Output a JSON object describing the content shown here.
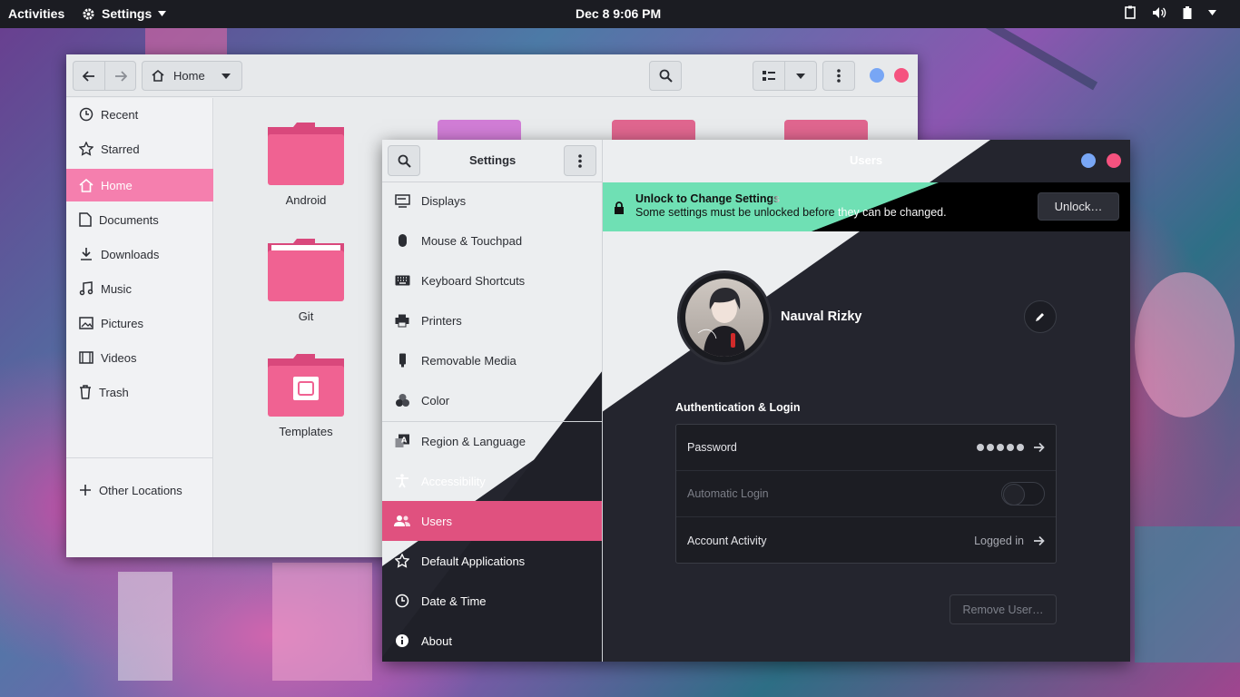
{
  "topbar": {
    "activities": "Activities",
    "app_menu": "Settings",
    "clock": "Dec 8  9:06 PM"
  },
  "files": {
    "path_label": "Home",
    "sidebar": [
      {
        "label": "Recent",
        "icon": "clock-icon"
      },
      {
        "label": "Starred",
        "icon": "star-icon"
      },
      {
        "label": "Home",
        "icon": "home-icon",
        "selected": true
      },
      {
        "label": "Documents",
        "icon": "document-icon"
      },
      {
        "label": "Downloads",
        "icon": "download-icon"
      },
      {
        "label": "Music",
        "icon": "music-icon"
      },
      {
        "label": "Pictures",
        "icon": "picture-icon"
      },
      {
        "label": "Videos",
        "icon": "video-icon"
      },
      {
        "label": "Trash",
        "icon": "trash-icon"
      },
      {
        "label": "Other Locations",
        "icon": "plus-icon"
      }
    ],
    "folders": [
      "Android",
      "Git",
      "Templates"
    ]
  },
  "settings": {
    "title": "Settings",
    "panel_title": "Users",
    "nav": [
      {
        "label": "Displays",
        "icon": "display-icon"
      },
      {
        "label": "Mouse & Touchpad",
        "icon": "mouse-icon"
      },
      {
        "label": "Keyboard Shortcuts",
        "icon": "keyboard-icon"
      },
      {
        "label": "Printers",
        "icon": "printer-icon"
      },
      {
        "label": "Removable Media",
        "icon": "usb-icon"
      },
      {
        "label": "Color",
        "icon": "color-icon"
      },
      {
        "label": "Region & Language",
        "icon": "language-icon"
      },
      {
        "label": "Accessibility",
        "icon": "accessibility-icon"
      },
      {
        "label": "Users",
        "icon": "users-icon",
        "selected": true
      },
      {
        "label": "Default Applications",
        "icon": "star-icon"
      },
      {
        "label": "Date & Time",
        "icon": "clock-icon"
      },
      {
        "label": "About",
        "icon": "info-icon"
      }
    ],
    "banner": {
      "title": "Unlock to Change Settings",
      "subtitle": "Some settings must be unlocked before they can be changed.",
      "button": "Unlock…"
    },
    "user": {
      "name": "Nauval Rizky",
      "section_title": "Authentication & Login",
      "password_label": "Password",
      "auto_login_label": "Automatic Login",
      "auto_login_enabled": false,
      "activity_label": "Account Activity",
      "activity_value": "Logged in",
      "remove_button": "Remove User…"
    }
  },
  "colors": {
    "accent_pink": "#f57fae",
    "selected_pink": "#e0517f",
    "banner_mint": "#6fe0b4",
    "window_dot_blue": "#78a6f5",
    "window_dot_red": "#f5527f"
  }
}
